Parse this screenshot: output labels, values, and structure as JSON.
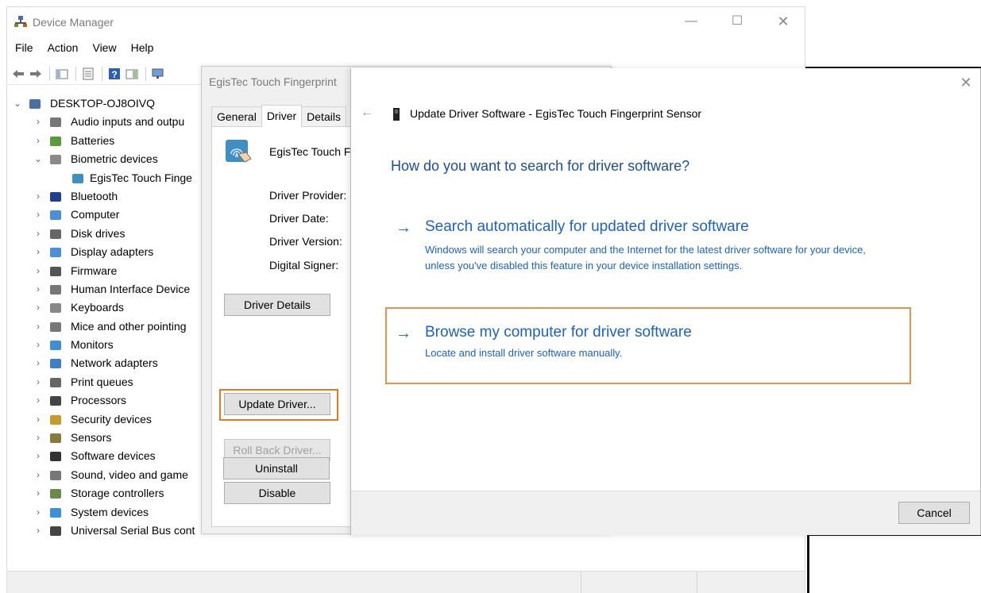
{
  "device_manager": {
    "title": "Device Manager",
    "window_controls": {
      "minimize": "—",
      "maximize": "☐",
      "close": "✕"
    },
    "menu": [
      "File",
      "Action",
      "View",
      "Help"
    ],
    "tree": {
      "root": "DESKTOP-OJ8OIVQ",
      "items": [
        {
          "label": "Audio inputs and outpu",
          "icon": "speaker-icon",
          "expanded": false
        },
        {
          "label": "Batteries",
          "icon": "battery-icon",
          "expanded": false
        },
        {
          "label": "Biometric devices",
          "icon": "fingerprint-reader-icon",
          "expanded": true
        },
        {
          "label": "EgisTec Touch Finge",
          "icon": "fingerprint-sensor-icon",
          "child": true
        },
        {
          "label": "Bluetooth",
          "icon": "bluetooth-icon",
          "expanded": false
        },
        {
          "label": "Computer",
          "icon": "computer-icon",
          "expanded": false
        },
        {
          "label": "Disk drives",
          "icon": "disk-drive-icon",
          "expanded": false
        },
        {
          "label": "Display adapters",
          "icon": "display-adapter-icon",
          "expanded": false
        },
        {
          "label": "Firmware",
          "icon": "firmware-icon",
          "expanded": false
        },
        {
          "label": "Human Interface Device",
          "icon": "hid-icon",
          "expanded": false
        },
        {
          "label": "Keyboards",
          "icon": "keyboard-icon",
          "expanded": false
        },
        {
          "label": "Mice and other pointing",
          "icon": "mouse-icon",
          "expanded": false
        },
        {
          "label": "Monitors",
          "icon": "monitor-icon",
          "expanded": false
        },
        {
          "label": "Network adapters",
          "icon": "network-adapter-icon",
          "expanded": false
        },
        {
          "label": "Print queues",
          "icon": "printer-icon",
          "expanded": false
        },
        {
          "label": "Processors",
          "icon": "processor-icon",
          "expanded": false
        },
        {
          "label": "Security devices",
          "icon": "security-device-icon",
          "expanded": false
        },
        {
          "label": "Sensors",
          "icon": "sensor-icon",
          "expanded": false
        },
        {
          "label": "Software devices",
          "icon": "software-device-icon",
          "expanded": false
        },
        {
          "label": "Sound, video and game",
          "icon": "speaker-icon",
          "expanded": false
        },
        {
          "label": "Storage controllers",
          "icon": "storage-controller-icon",
          "expanded": false
        },
        {
          "label": "System devices",
          "icon": "system-device-icon",
          "expanded": false
        },
        {
          "label": "Universal Serial Bus cont",
          "icon": "usb-icon",
          "expanded": false
        }
      ]
    }
  },
  "properties": {
    "title": "EgisTec Touch Fingerprint",
    "tabs": [
      "General",
      "Driver",
      "Details"
    ],
    "active_tab": "Driver",
    "device_name": "EgisTec Touch F",
    "fields": [
      "Driver Provider:",
      "Driver Date:",
      "Driver Version:",
      "Digital Signer:"
    ],
    "buttons": {
      "driver_details": "Driver Details",
      "update_driver": "Update Driver...",
      "roll_back": "Roll Back Driver...",
      "disable": "Disable",
      "uninstall": "Uninstall"
    }
  },
  "update_dialog": {
    "close": "✕",
    "back": "←",
    "header": "Update Driver Software - EgisTec Touch Fingerprint Sensor",
    "question": "How do you want to search for driver software?",
    "option_auto": {
      "arrow": "→",
      "title": "Search automatically for updated driver software",
      "desc": "Windows will search your computer and the Internet for the latest driver software for your device, unless you've disabled this feature in your device installation settings."
    },
    "option_browse": {
      "arrow": "→",
      "title": "Browse my computer for driver software",
      "desc": "Locate and install driver software manually."
    },
    "cancel": "Cancel"
  },
  "colors": {
    "link_blue": "#1a62c7",
    "heading_blue": "#1a4e9c",
    "highlight_orange": "#e07a1f"
  }
}
